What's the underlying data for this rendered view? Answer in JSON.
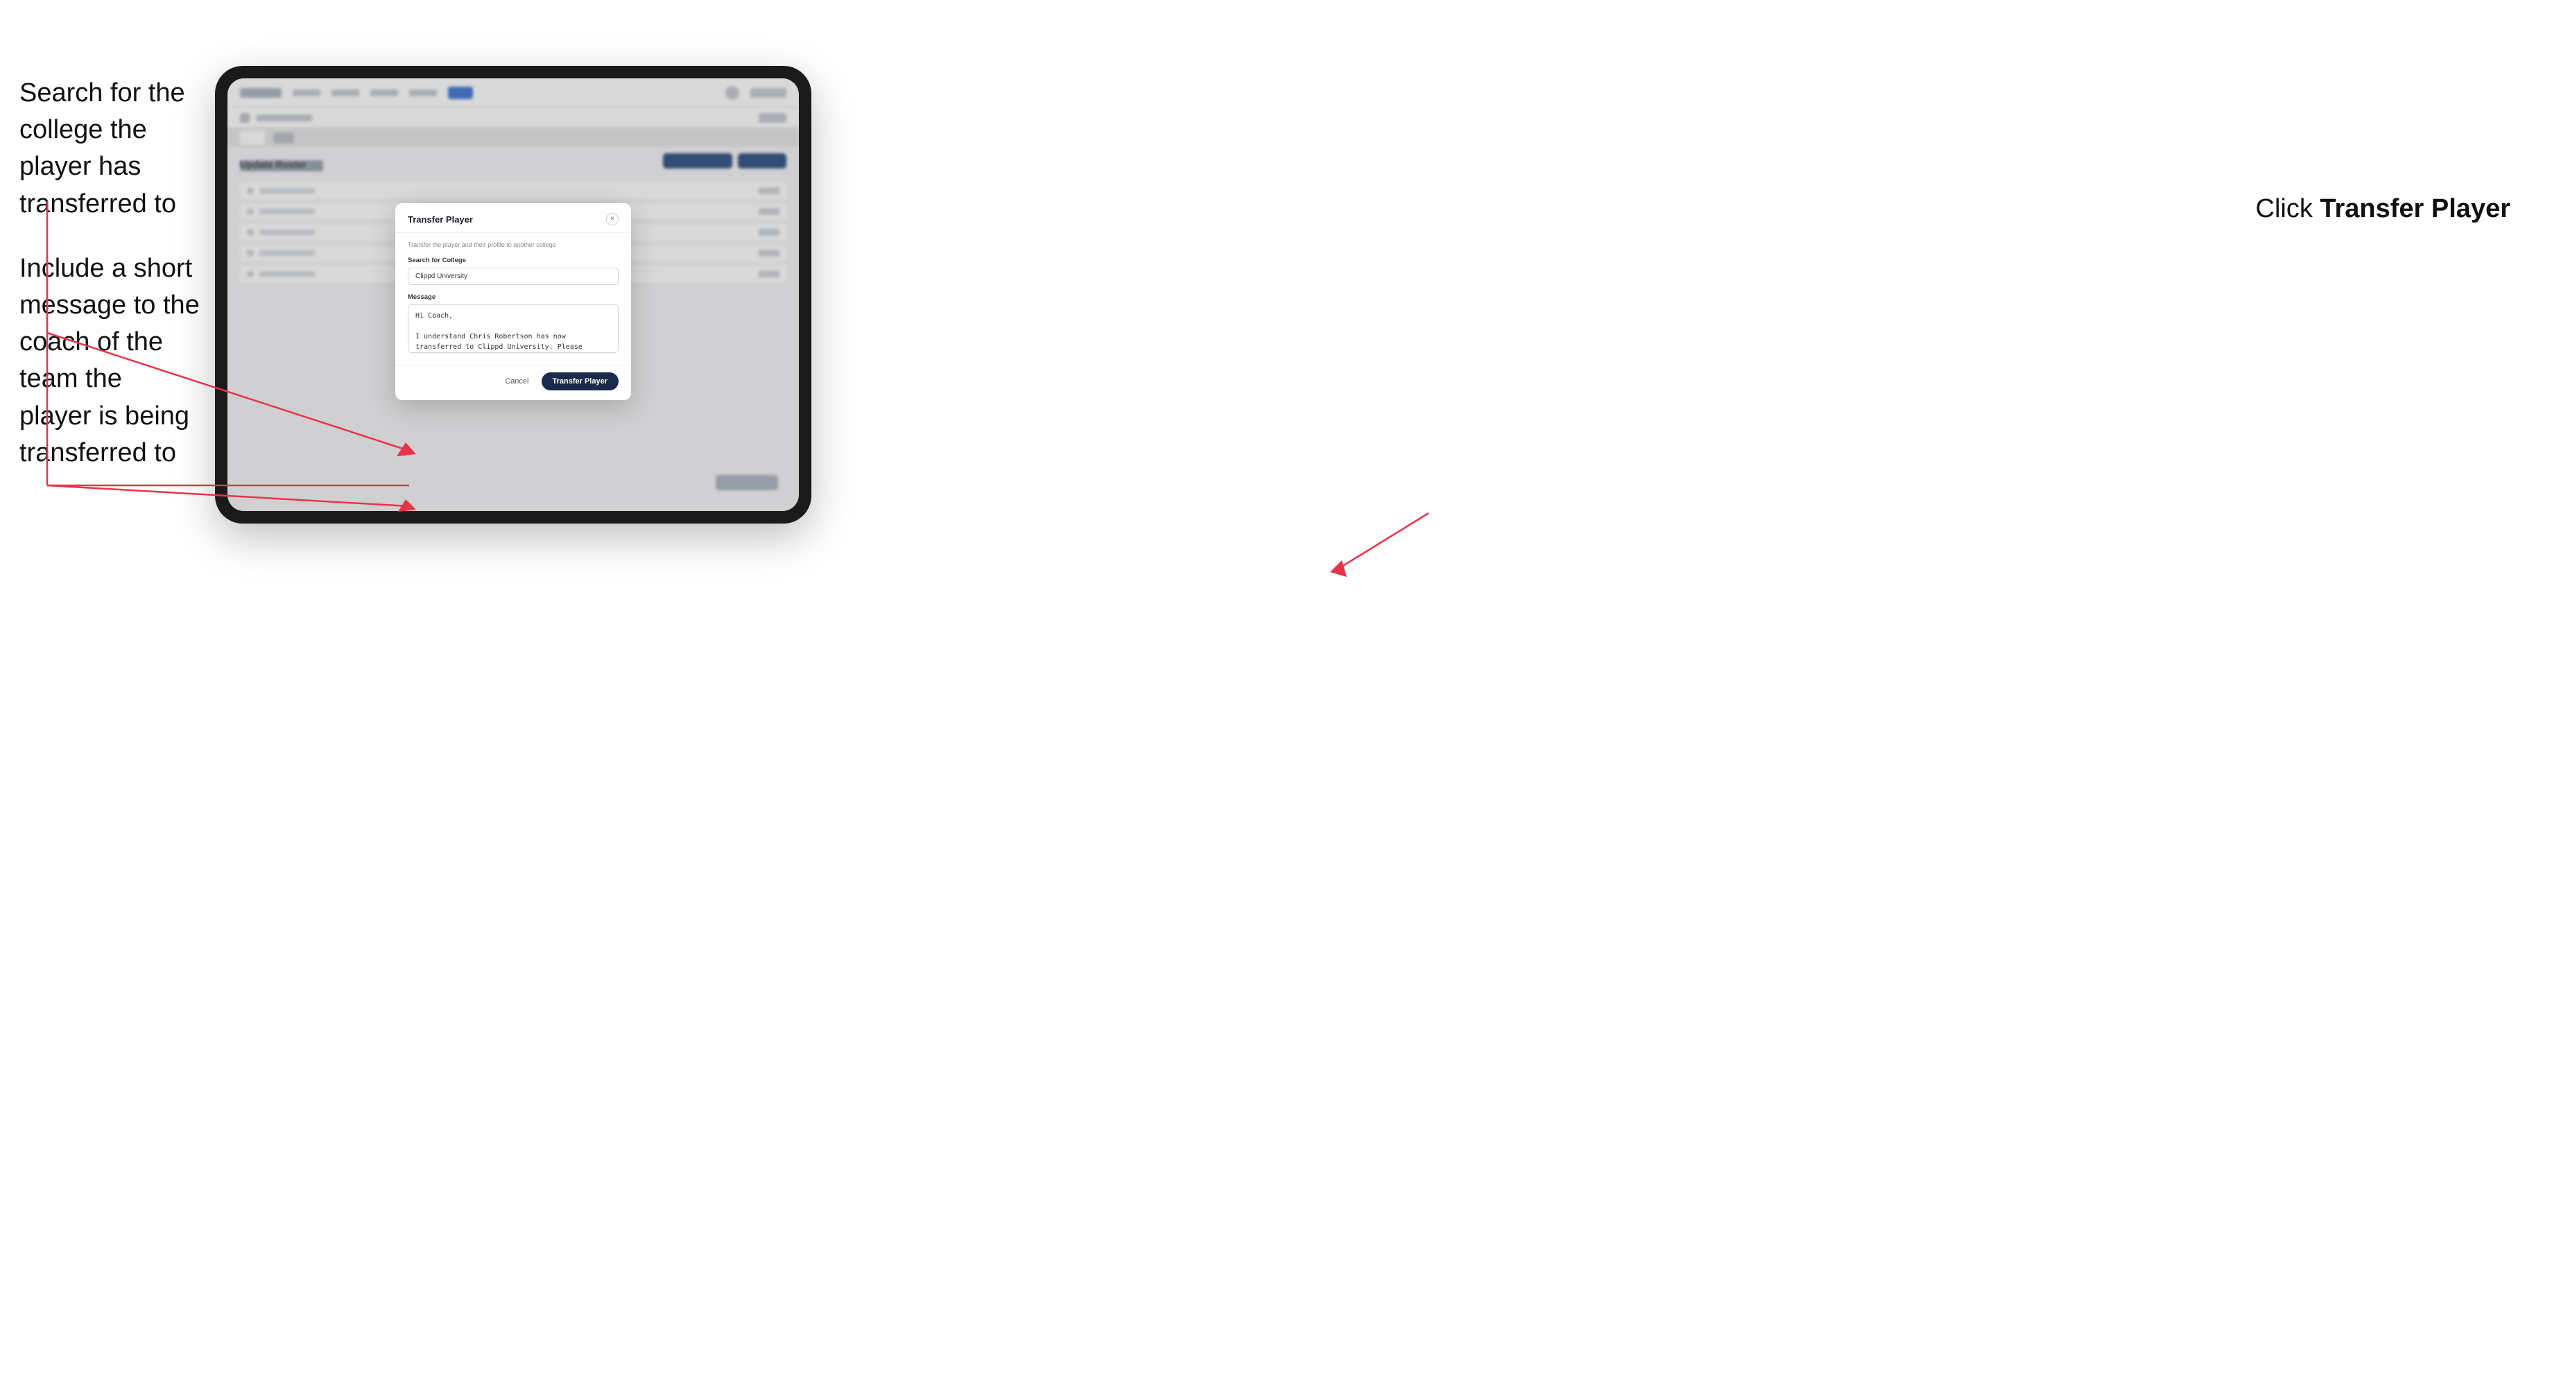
{
  "annotations": {
    "left_line1": "Search for the college the player has transferred to",
    "left_line2": "Include a short message to the coach of the team the player is being transferred to",
    "right_text_prefix": "Click ",
    "right_text_bold": "Transfer Player"
  },
  "tablet": {
    "navbar": {
      "logo_alt": "App logo",
      "items": [
        "nav1",
        "nav2",
        "nav3",
        "nav4"
      ],
      "active_tab": "active"
    },
    "page_title": "Update Roster"
  },
  "modal": {
    "title": "Transfer Player",
    "subtitle": "Transfer the player and their profile to another college",
    "college_label": "Search for College",
    "college_value": "Clippd University",
    "message_label": "Message",
    "message_value": "Hi Coach,\n\nI understand Chris Robertson has now transferred to Clippd University. Please accept this transfer request when you can.",
    "cancel_label": "Cancel",
    "transfer_label": "Transfer Player",
    "close_icon": "×"
  }
}
